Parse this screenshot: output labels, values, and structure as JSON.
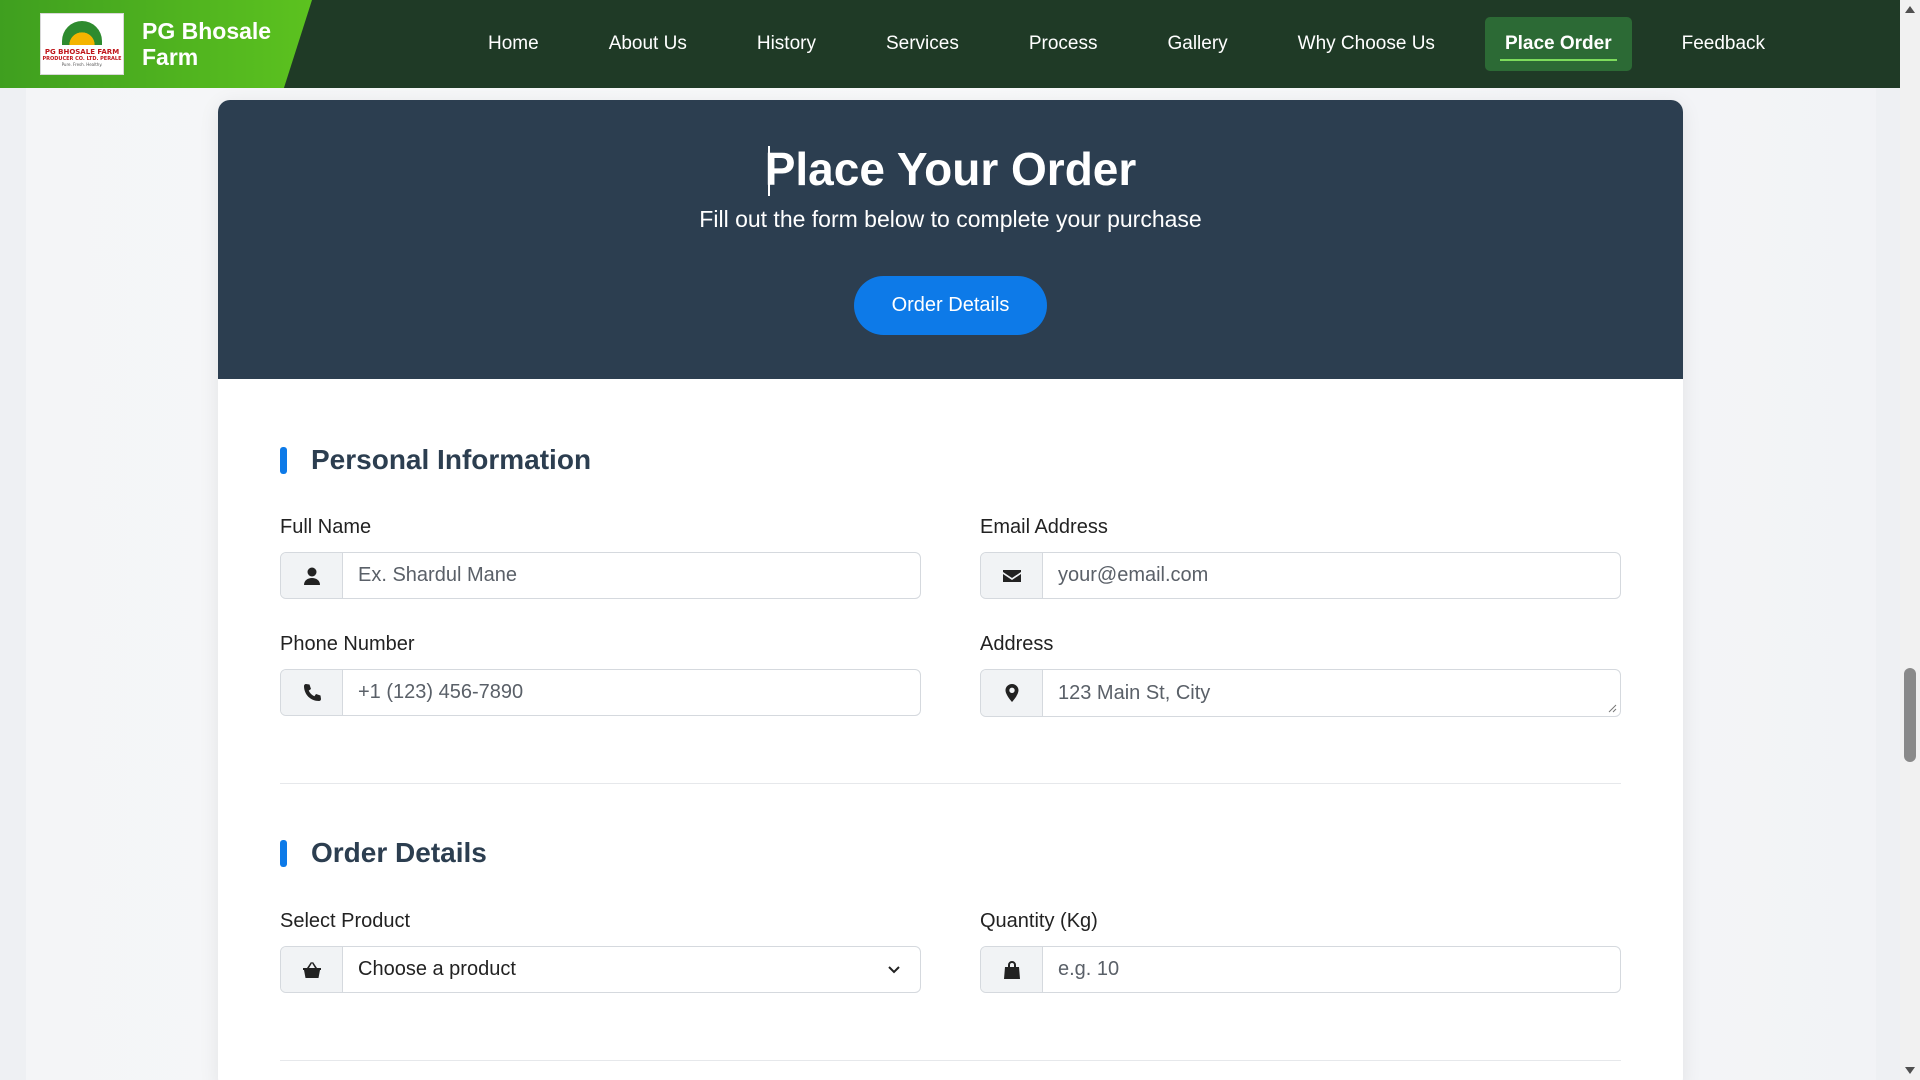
{
  "brand": {
    "name": "PG Bhosale Farm",
    "logo_line1": "PG BHOSALE FARM",
    "logo_line2": "PRODUCER CO. LTD. PERALE",
    "logo_line3": "Pure. Fresh. Healthy."
  },
  "nav": {
    "items": [
      {
        "label": "Home"
      },
      {
        "label": "About Us"
      },
      {
        "label": "History"
      },
      {
        "label": "Services"
      },
      {
        "label": "Process"
      },
      {
        "label": "Gallery"
      },
      {
        "label": "Why Choose Us"
      },
      {
        "label": "Place Order",
        "active": true
      },
      {
        "label": "Feedback"
      }
    ]
  },
  "header": {
    "title": "Place Your Order",
    "subtitle": "Fill out the form below to complete your purchase",
    "button_label": "Order Details"
  },
  "personal": {
    "heading": "Personal Information",
    "full_name": {
      "label": "Full Name",
      "placeholder": "Ex. Shardul Mane",
      "icon": "user-icon"
    },
    "email": {
      "label": "Email Address",
      "placeholder": "your@email.com",
      "icon": "envelope-icon"
    },
    "phone": {
      "label": "Phone Number",
      "placeholder": "+1 (123) 456-7890",
      "icon": "phone-icon"
    },
    "address": {
      "label": "Address",
      "placeholder": "123 Main St, City",
      "icon": "map-marker-icon"
    }
  },
  "order": {
    "heading": "Order Details",
    "product": {
      "label": "Select Product",
      "selected": "Choose a product",
      "icon": "shopping-basket-icon"
    },
    "quantity": {
      "label": "Quantity (Kg)",
      "placeholder": "e.g. 10",
      "icon": "shopping-bag-icon"
    }
  },
  "colors": {
    "navbar": "#1f3a26",
    "brand_green": "#5cc21f",
    "header_bg": "#2c3e50",
    "accent_blue": "#0d7ae8"
  }
}
